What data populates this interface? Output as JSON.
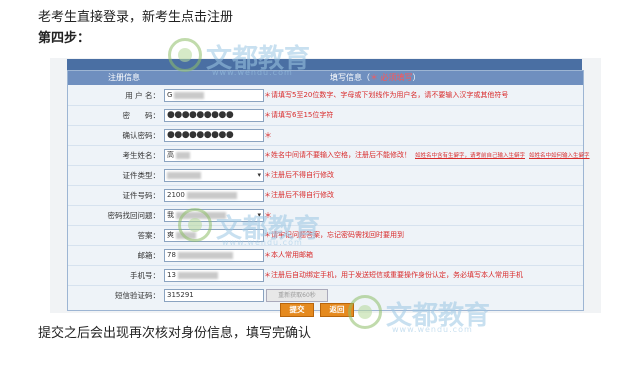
{
  "intro": "老考生直接登录，新考生点击注册",
  "step": "第四步：",
  "outro": "提交之后会出现再次核对身份信息，填写完确认",
  "form": {
    "header_left": "注册信息",
    "header_right": "填写信息（",
    "header_req": "＊ 必须填写",
    "header_end": "）",
    "rows": [
      {
        "label": "用 户 名：",
        "value": "G",
        "hint": "＊请填写5至20位数字、字母或下划线作为用户名，请不要输入汉字或其他符号"
      },
      {
        "label": "密　　码：",
        "value": "●●●●●●●●●",
        "hint": "＊请填写6至15位字符"
      },
      {
        "label": "确认密码：",
        "value": "●●●●●●●●●",
        "hint": "＊"
      },
      {
        "label": "考生姓名：",
        "value": "高",
        "hint": "＊姓名中间请不要输入空格，注册后不能修改！",
        "link1": "如姓名中含有生僻字，请考前自己输入生僻字",
        "link2": "如姓名中如何输入生僻字"
      },
      {
        "label": "证件类型：",
        "value": "",
        "hint": "＊注册后不得自行修改"
      },
      {
        "label": "证件号码：",
        "value": "2100",
        "hint": "＊注册后不得自行修改"
      },
      {
        "label": "密码找回问题：",
        "value": "我",
        "hint": "＊"
      },
      {
        "label": "答案：",
        "value": "爽",
        "hint": "＊请牢记问题答案，忘记密码需找回时要用到"
      },
      {
        "label": "邮箱：",
        "value": "78",
        "hint": "＊本人常用邮箱"
      },
      {
        "label": "手机号：",
        "value": "13",
        "hint": "＊注册后自动绑定手机，用于发送短信或重要操作身份认定，务必填写本人常用手机"
      },
      {
        "label": "短信验证码：",
        "value": "315291",
        "hint": ""
      }
    ],
    "get_code": "重新获取60秒",
    "submit": "提交",
    "back": "返回"
  },
  "watermark": {
    "brand": "文都教育",
    "url": "www.wendu.com"
  },
  "colors": {
    "header": "#6f8fbf",
    "topbar": "#4a6fa3",
    "hint": "#d92b2b",
    "button": "#e58a1f"
  }
}
